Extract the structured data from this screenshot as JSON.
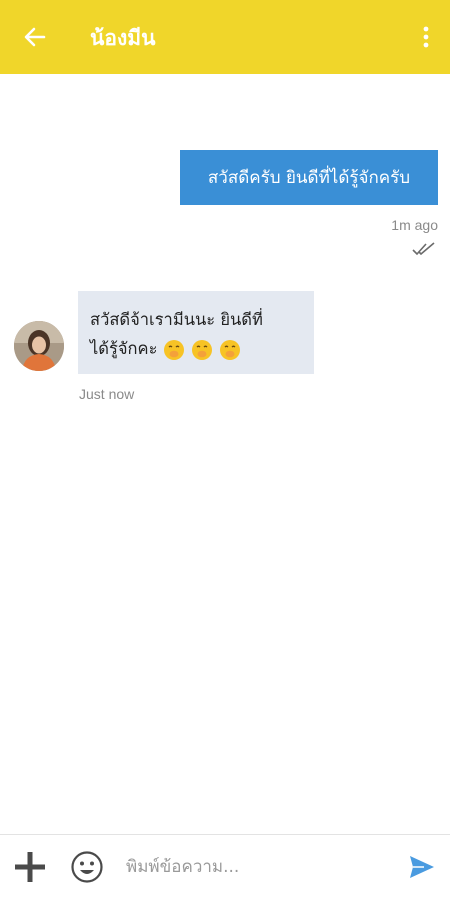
{
  "header": {
    "title": "น้องมีน",
    "back_icon": "arrow-left-icon",
    "menu_icon": "more-vertical-icon",
    "background_color": "#f0d62a"
  },
  "messages": [
    {
      "direction": "outgoing",
      "text": "สวัสดีครับ ยินดีที่ได้รู้จักครับ",
      "time": "1m ago",
      "status_icon": "double-check-icon",
      "bubble_color": "#3a8fd6"
    },
    {
      "direction": "incoming",
      "text_line1": "สวัสดีจ้าเรามีนนะ ยินดีที่",
      "text_line2": "ได้รู้จักคะ",
      "emoji_icons": [
        "shushing-face-icon",
        "shushing-face-icon",
        "shushing-face-icon"
      ],
      "time": "Just now",
      "avatar_icon": "user-avatar",
      "bubble_color": "#e4e9f1"
    }
  ],
  "composer": {
    "placeholder": "พิมพ์ข้อความ...",
    "add_icon": "plus-icon",
    "emoji_icon": "smiley-icon",
    "send_icon": "send-icon",
    "send_color": "#4a9be0"
  }
}
